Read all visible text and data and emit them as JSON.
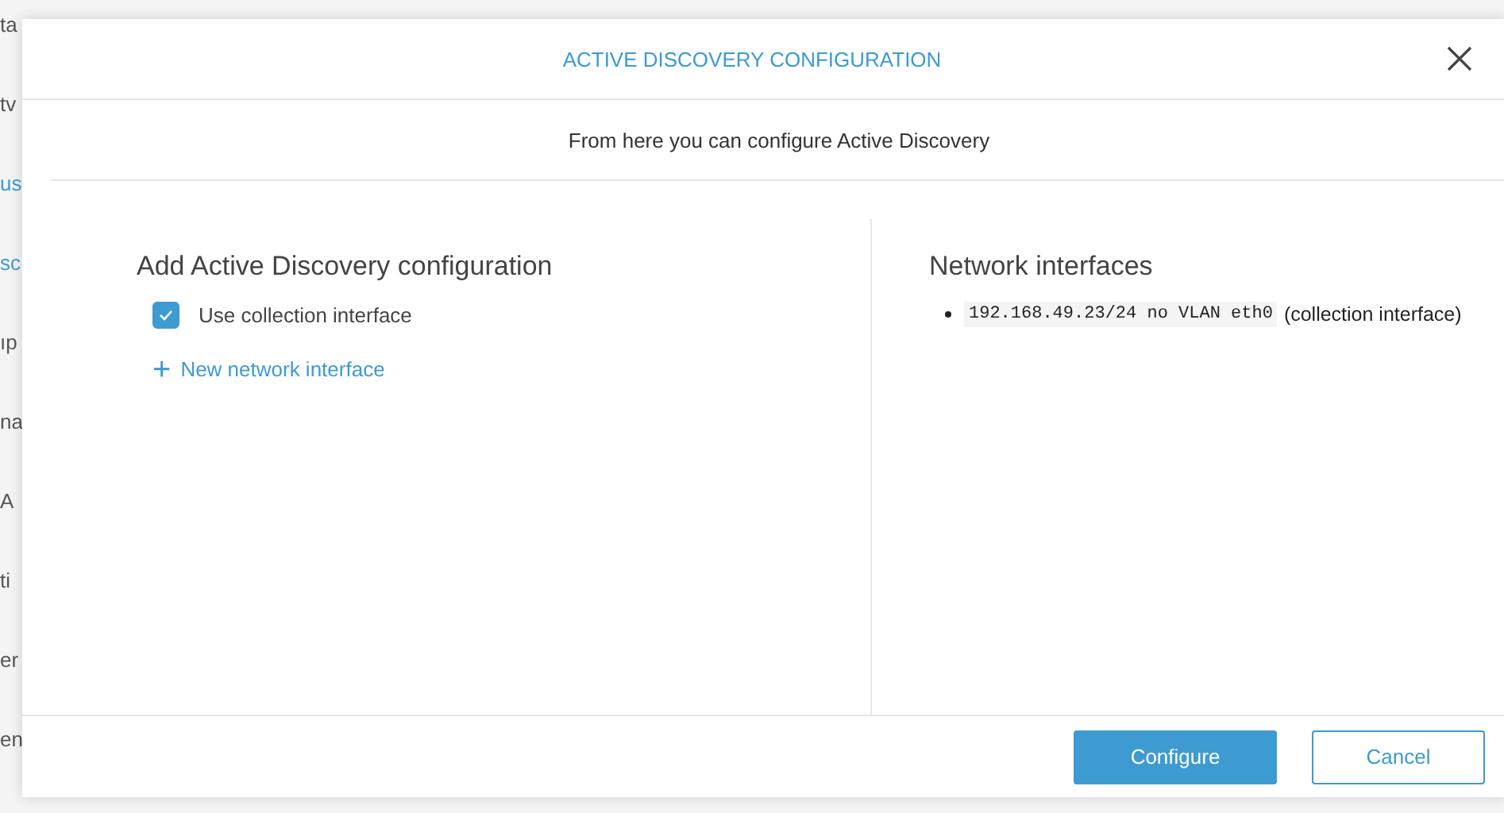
{
  "background": {
    "sidebar_fragments": [
      "ta",
      "tv",
      "us",
      "sc",
      "ıp",
      "na",
      "A",
      "ti",
      "er",
      "en"
    ]
  },
  "dialog": {
    "title": "ACTIVE DISCOVERY CONFIGURATION",
    "subtitle": "From here you can configure Active Discovery",
    "left": {
      "heading": "Add Active Discovery configuration",
      "checkbox": {
        "label": "Use collection interface",
        "checked": true
      },
      "add_link": {
        "icon": "+",
        "label": "New network interface"
      }
    },
    "right": {
      "heading": "Network interfaces",
      "interfaces": [
        {
          "code": "192.168.49.23/24 no VLAN eth0",
          "note": "(collection interface)"
        }
      ]
    },
    "buttons": [
      {
        "label": "Configure",
        "kind": "primary"
      },
      {
        "label": "Cancel",
        "kind": "secondary"
      }
    ]
  }
}
